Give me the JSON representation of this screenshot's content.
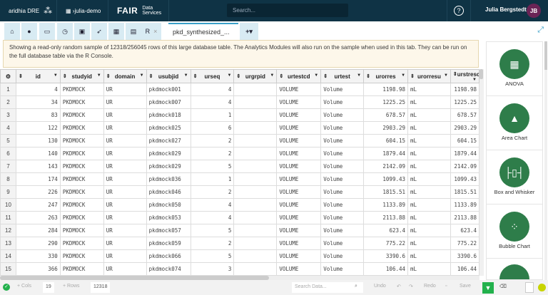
{
  "header": {
    "logo_text": "aridhia DRE",
    "project": "julia-demo",
    "fair": "FAIR",
    "fair_sub": "Data Services",
    "search_placeholder": "Search...",
    "help": "?",
    "user_name": "Julia Bergstedt",
    "user_initials": "JB"
  },
  "tabs": {
    "icons": [
      "home-icon",
      "chat-icon",
      "monitor-icon",
      "clock-icon",
      "play-icon",
      "rocket-icon",
      "table-icon",
      "file-icon"
    ],
    "r_label": "R",
    "active_label": "pkd_synthesized_...",
    "close": "×",
    "add": "+▾",
    "expand": "⤢"
  },
  "notice": "Showing a read-only random sample of 12318/256045 rows of this large database table. The Analytics Modules will also run on the sample when used in this tab. They can be run on the full database table via the R Console.",
  "table": {
    "columns": [
      "id",
      "studyid",
      "domain",
      "usubjid",
      "urseq",
      "urgrpid",
      "urtestcd",
      "urtest",
      "urorres",
      "urorresu",
      "urstresc"
    ],
    "rows": [
      [
        "1",
        "4",
        "PKDMOCK",
        "UR",
        "pkdmock001",
        "4",
        "",
        "VOLUME",
        "Volume",
        "1198.98",
        "mL",
        "1198.98"
      ],
      [
        "2",
        "34",
        "PKDMOCK",
        "UR",
        "pkdmock007",
        "4",
        "",
        "VOLUME",
        "Volume",
        "1225.25",
        "mL",
        "1225.25"
      ],
      [
        "3",
        "83",
        "PKDMOCK",
        "UR",
        "pkdmock018",
        "1",
        "",
        "VOLUME",
        "Volume",
        "678.57",
        "mL",
        "678.57"
      ],
      [
        "4",
        "122",
        "PKDMOCK",
        "UR",
        "pkdmock025",
        "6",
        "",
        "VOLUME",
        "Volume",
        "2903.29",
        "mL",
        "2903.29"
      ],
      [
        "5",
        "130",
        "PKDMOCK",
        "UR",
        "pkdmock027",
        "2",
        "",
        "VOLUME",
        "Volume",
        "604.15",
        "mL",
        "604.15"
      ],
      [
        "6",
        "140",
        "PKDMOCK",
        "UR",
        "pkdmock029",
        "2",
        "",
        "VOLUME",
        "Volume",
        "1879.44",
        "mL",
        "1879.44"
      ],
      [
        "7",
        "143",
        "PKDMOCK",
        "UR",
        "pkdmock029",
        "5",
        "",
        "VOLUME",
        "Volume",
        "2142.09",
        "mL",
        "2142.09"
      ],
      [
        "8",
        "174",
        "PKDMOCK",
        "UR",
        "pkdmock036",
        "1",
        "",
        "VOLUME",
        "Volume",
        "1099.43",
        "mL",
        "1099.43"
      ],
      [
        "9",
        "226",
        "PKDMOCK",
        "UR",
        "pkdmock046",
        "2",
        "",
        "VOLUME",
        "Volume",
        "1815.51",
        "mL",
        "1815.51"
      ],
      [
        "10",
        "247",
        "PKDMOCK",
        "UR",
        "pkdmock050",
        "4",
        "",
        "VOLUME",
        "Volume",
        "1133.89",
        "mL",
        "1133.89"
      ],
      [
        "11",
        "263",
        "PKDMOCK",
        "UR",
        "pkdmock053",
        "4",
        "",
        "VOLUME",
        "Volume",
        "2113.88",
        "mL",
        "2113.88"
      ],
      [
        "12",
        "284",
        "PKDMOCK",
        "UR",
        "pkdmock057",
        "5",
        "",
        "VOLUME",
        "Volume",
        "623.4",
        "mL",
        "623.4"
      ],
      [
        "13",
        "290",
        "PKDMOCK",
        "UR",
        "pkdmock059",
        "2",
        "",
        "VOLUME",
        "Volume",
        "775.22",
        "mL",
        "775.22"
      ],
      [
        "14",
        "330",
        "PKDMOCK",
        "UR",
        "pkdmock066",
        "5",
        "",
        "VOLUME",
        "Volume",
        "3390.6",
        "mL",
        "3390.6"
      ],
      [
        "15",
        "366",
        "PKDMOCK",
        "UR",
        "pkdmock074",
        "3",
        "",
        "VOLUME",
        "Volume",
        "106.44",
        "mL",
        "106.44"
      ]
    ]
  },
  "modules": [
    {
      "label": "ANOVA",
      "icon": "anova-icon",
      "glyph": "▦"
    },
    {
      "label": "Area Chart",
      "icon": "area-chart-icon",
      "glyph": "▲"
    },
    {
      "label": "Box and Whisker",
      "icon": "box-whisker-icon",
      "glyph": "├▯┤"
    },
    {
      "label": "Bubble Chart",
      "icon": "bubble-chart-icon",
      "glyph": "⁘"
    }
  ],
  "footer": {
    "cols_label": "+ Cols",
    "cols": "19",
    "rows_label": "+ Rows",
    "rows": "12318",
    "search_placeholder": "Search Data...",
    "undo": "Undo",
    "redo": "Redo",
    "save": "Save"
  },
  "colors": {
    "header": "#0f3345",
    "accent": "#3aa0c8",
    "module": "#2e7d4a",
    "filter": "#22b14c"
  }
}
